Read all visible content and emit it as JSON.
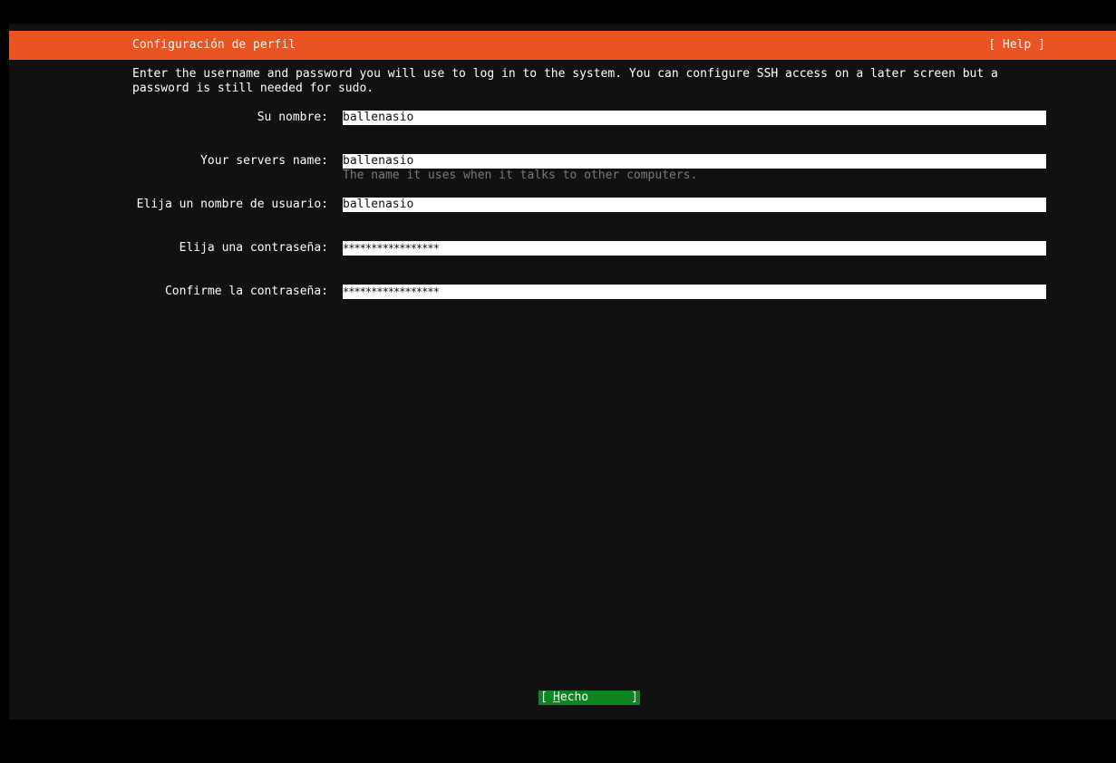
{
  "header": {
    "title": "Configuración de perfil",
    "help_label": "[ Help ]"
  },
  "intro_text": "Enter the username and password you will use to log in to the system. You can configure SSH access on a later screen but a\npassword is still needed for sudo.",
  "form": {
    "fields": [
      {
        "label": "Su nombre:",
        "value": "ballenasio"
      },
      {
        "label": "Your servers name:",
        "value": "ballenasio",
        "hint": "The name it uses when it talks to other computers."
      },
      {
        "label": "Elija un nombre de usuario:",
        "value": "ballenasio"
      },
      {
        "label": "Elija una contraseña:",
        "value": "*****************"
      },
      {
        "label": "Confirme la contraseña:",
        "value": "*****************"
      }
    ]
  },
  "done_button": {
    "bracket_left": "[",
    "hotkey": "H",
    "label_rest": "echo",
    "bracket_right": "]"
  },
  "colors": {
    "header_bg": "#e95420",
    "screen_bg": "#111111",
    "button_bg": "#0e8420",
    "hint_text": "#7a7a7a"
  }
}
